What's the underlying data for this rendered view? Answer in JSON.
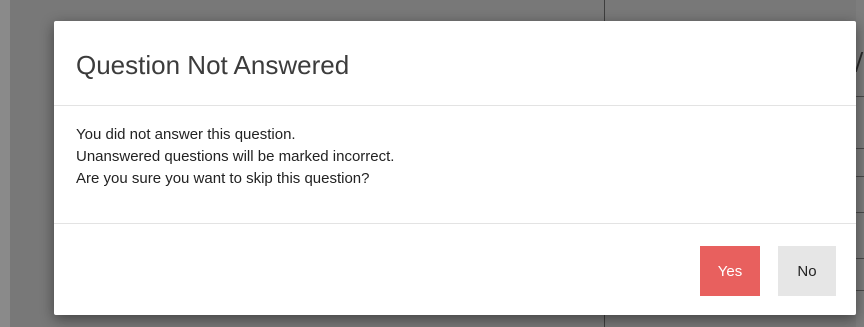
{
  "dialog": {
    "title": "Question Not Answered",
    "message_lines": [
      "You did not answer this question.",
      "Unanswered questions will be marked incorrect.",
      "Are you sure you want to skip this question?"
    ],
    "buttons": {
      "yes_label": "Yes",
      "no_label": "No"
    }
  },
  "colors": {
    "backdrop": "#787878",
    "yes_button": "#e8605e",
    "no_button": "#e6e6e6",
    "title_text": "#3c3c3c"
  }
}
